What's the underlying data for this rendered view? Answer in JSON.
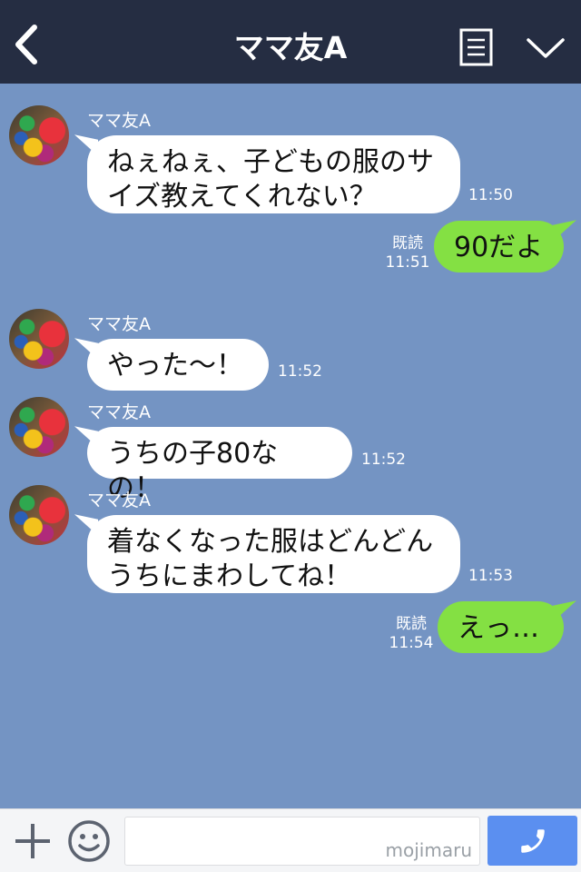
{
  "header": {
    "title": "ママ友A"
  },
  "messages": [
    {
      "sender": "ママ友A",
      "line1": "ねぇねぇ、子どもの服のサ",
      "line2": "イズ教えてくれない？",
      "time": "11:50"
    },
    {
      "text": "90だよ",
      "read": "既読",
      "time": "11:51"
    },
    {
      "sender": "ママ友A",
      "text": "やった〜！",
      "time": "11:52"
    },
    {
      "sender": "ママ友A",
      "text": "うちの子80なの！",
      "time": "11:52"
    },
    {
      "sender": "ママ友A",
      "line1": "着なくなった服はどんどん",
      "line2": "うちにまわしてね！",
      "time": "11:53"
    },
    {
      "text": "えっ…",
      "read": "既読",
      "time": "11:54"
    }
  ],
  "footer": {
    "input_value": "",
    "watermark": "mojimaru"
  },
  "icons": {
    "back": "chevron-left-icon",
    "menu": "menu-icon",
    "down": "chevron-down-icon",
    "plus": "plus-icon",
    "emoji": "smiley-icon",
    "call": "phone-icon"
  },
  "colors": {
    "header_bg": "#252d42",
    "chat_bg": "#7494c3",
    "incoming_bubble": "#ffffff",
    "outgoing_bubble": "#84e043",
    "call_button": "#5b8ff0"
  }
}
